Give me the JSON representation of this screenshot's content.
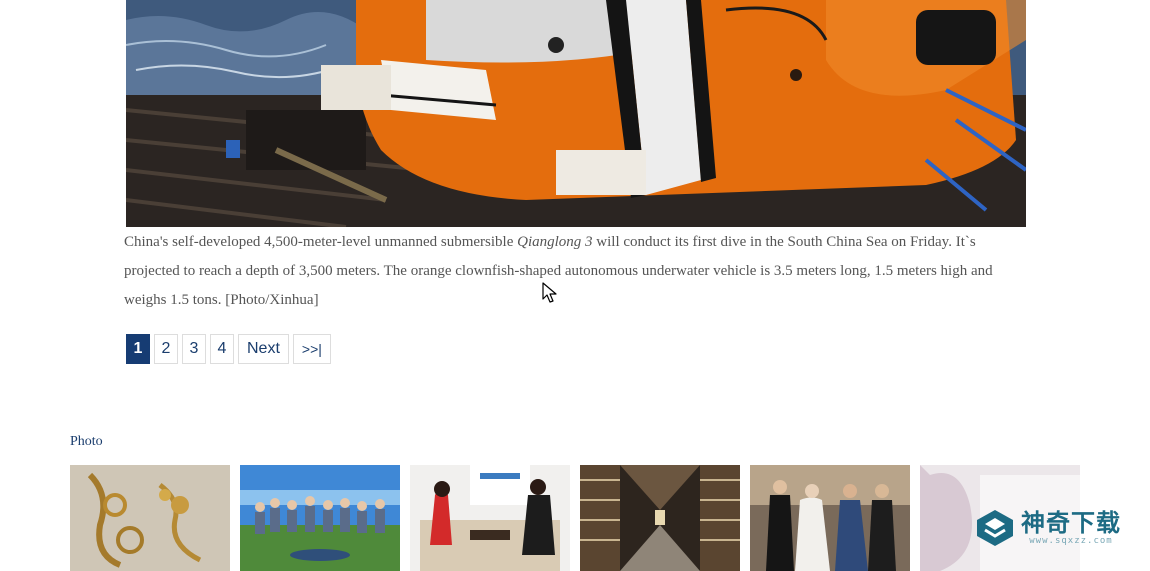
{
  "article": {
    "image_alt": "Qianglong 3 submersible",
    "caption_part1": "China's self-developed 4,500-meter-level unmanned submersible ",
    "caption_italic": "Qianglong 3",
    "caption_part2": " will conduct its first dive in the South China Sea on Friday. It`s projected to reach a depth of 3,500 meters. The orange clownfish-shaped autonomous underwater vehicle is 3.5 meters long, 1.5 meters high and weighs 1.5 tons. [Photo/Xinhua]"
  },
  "pagination": {
    "pages": [
      "1",
      "2",
      "3",
      "4"
    ],
    "current": "1",
    "next_label": "Next",
    "last_label": ">>|"
  },
  "photo_section": {
    "label": "Photo",
    "thumbnails": [
      {
        "icon": "gold-jewelry-photo"
      },
      {
        "icon": "group-photo"
      },
      {
        "icon": "interview-photo"
      },
      {
        "icon": "library-photo"
      },
      {
        "icon": "gala-photo"
      },
      {
        "icon": "faded-photo"
      }
    ]
  },
  "watermark": {
    "main": "神奇下载",
    "sub": "www.sqxzz.com"
  },
  "colors": {
    "accent": "#163c73",
    "link": "#1a3d6d",
    "caption_text": "#555555",
    "submersible_orange": "#e46d0d"
  }
}
